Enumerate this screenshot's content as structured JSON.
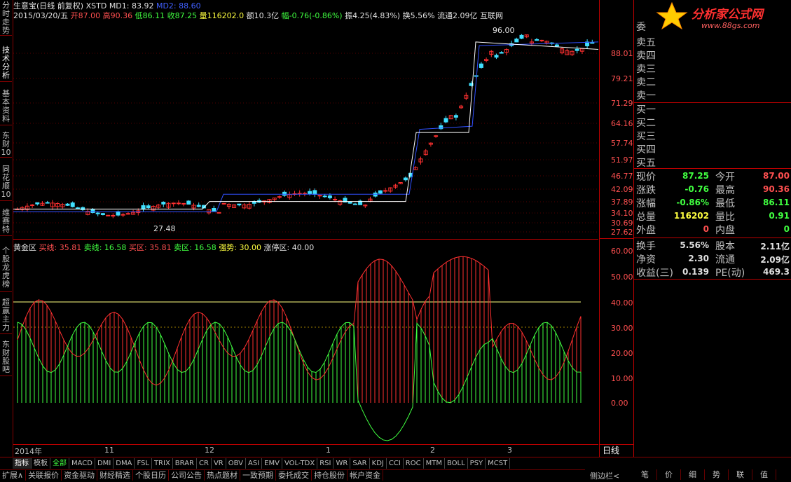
{
  "left_tabs": [
    "分时走势",
    "技术分析",
    "基本资料",
    "东财10",
    "同花顺10",
    "维赛特",
    "个股龙虎榜",
    "超赢主力",
    "东财股吧"
  ],
  "main": {
    "stock_name": "生意宝(日线 前复权)",
    "xstd": "XSTD",
    "md1": "MD1: 83.92",
    "md2": "MD2: 88.60",
    "date": "2015/03/20/五",
    "open": "开87.00",
    "high": "高90.36",
    "low": "低86.11",
    "close": "收87.25",
    "volume": "量116202.0",
    "amount": "额10.3亿",
    "change": "幅-0.76(-0.86%)",
    "amplitude": "振4.25(4.83%)",
    "turnover": "换5.56%",
    "float": "流通2.09亿",
    "sector": "互联网",
    "high_mark": "96.00",
    "low_mark": "27.48"
  },
  "indicator": {
    "name": "黄金区",
    "buy_line": "买线: 35.81",
    "sell_line": "卖线: 16.58",
    "buy_zone": "买区: 35.81",
    "sell_zone": "卖区: 16.58",
    "strong": "强势: 30.00",
    "limit_zone": "涨停区: 40.00"
  },
  "price_axis": [
    "88.01",
    "79.21",
    "71.29",
    "64.16",
    "57.74",
    "51.97",
    "46.77",
    "42.09",
    "37.89",
    "34.10",
    "30.69",
    "27.62"
  ],
  "indicator_axis": [
    "60.00",
    "50.00",
    "40.00",
    "30.00",
    "20.00",
    "10.00",
    "0.00"
  ],
  "date_axis": [
    "2014年",
    "11",
    "12",
    "1",
    "2",
    "3"
  ],
  "period": "日线",
  "quote": {
    "sells": [
      "卖五",
      "卖四",
      "卖三",
      "卖二",
      "卖一"
    ],
    "buys": [
      "买一",
      "买二",
      "买三",
      "买四",
      "买五"
    ],
    "stats": [
      {
        "l1": "现价",
        "v1": "87.25",
        "c1": "#40ff40",
        "l2": "今开",
        "v2": "87.00",
        "c2": "#ff5050"
      },
      {
        "l1": "涨跌",
        "v1": "-0.76",
        "c1": "#40ff40",
        "l2": "最高",
        "v2": "90.36",
        "c2": "#ff5050"
      },
      {
        "l1": "涨幅",
        "v1": "-0.86%",
        "c1": "#40ff40",
        "l2": "最低",
        "v2": "86.11",
        "c2": "#40ff40"
      },
      {
        "l1": "总量",
        "v1": "116202",
        "c1": "#ffff40",
        "l2": "量比",
        "v2": "0.91",
        "c2": "#40ff40"
      },
      {
        "l1": "外盘",
        "v1": "0",
        "c1": "#ff5050",
        "l2": "内盘",
        "v2": "0",
        "c2": "#40ff40"
      }
    ],
    "stats2": [
      {
        "l1": "换手",
        "v1": "5.56%",
        "l2": "股本",
        "v2": "2.11亿"
      },
      {
        "l1": "净资",
        "v1": "2.30",
        "l2": "流通",
        "v2": "2.09亿"
      },
      {
        "l1": "收益(三)",
        "v1": "0.139",
        "l2": "PE(动)",
        "v2": "469.3"
      }
    ]
  },
  "logo": {
    "text": "分析家公式网",
    "url": "www.88gs.com"
  },
  "indicator_tabs": [
    "指标",
    "模板",
    "全部",
    "MACD",
    "DMI",
    "DMA",
    "FSL",
    "TRIX",
    "BRAR",
    "CR",
    "VR",
    "OBV",
    "ASI",
    "EMV",
    "VOL-TDX",
    "RSI",
    "WR",
    "SAR",
    "KDJ",
    "CCI",
    "ROC",
    "MTM",
    "BOLL",
    "PSY",
    "MCST"
  ],
  "status_tabs": [
    "扩展∧",
    "关联报价",
    "资金驱动",
    "财经精选",
    "个股日历",
    "公司公告",
    "热点题材",
    "一致预期",
    "委托成交",
    "持仓股份",
    "帐户资金"
  ],
  "side_label": "侧边栏<",
  "right_bottom_tabs": [
    "笔",
    "价",
    "细",
    "势",
    "联",
    "值"
  ],
  "colors": {
    "up": "#ff3030",
    "down": "#40e0ff",
    "frame": "#b00000"
  }
}
